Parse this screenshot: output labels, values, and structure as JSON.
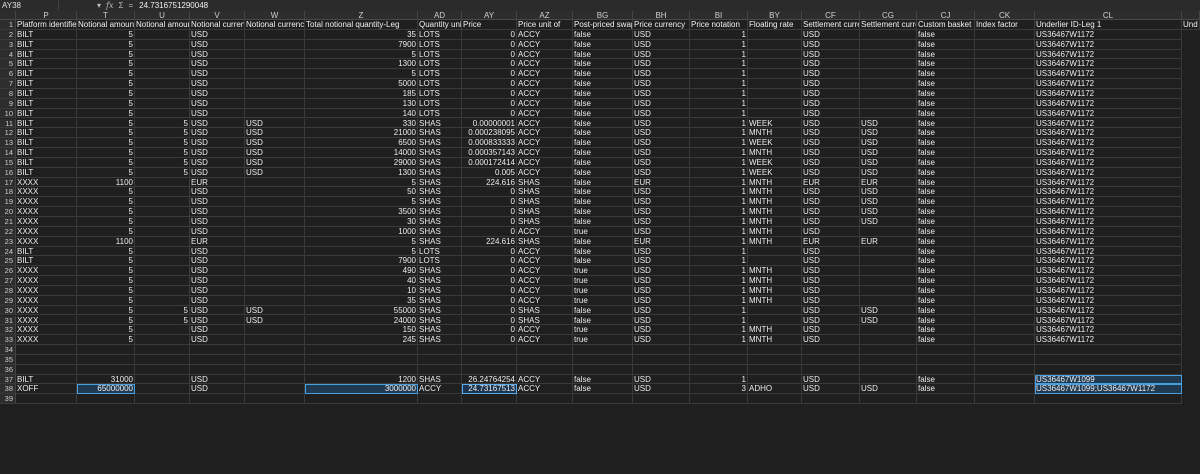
{
  "name_box": "AY38",
  "formula": {
    "fx": "fx",
    "sum": "Σ",
    "dropdown": "▾",
    "equals": "=",
    "value": "24.7316751290048"
  },
  "columns": [
    "P",
    "T",
    "U",
    "V",
    "W",
    "Z",
    "AD",
    "AY",
    "AZ",
    "BG",
    "BH",
    "BI",
    "BY",
    "CF",
    "CG",
    "CJ",
    "CK",
    "CL"
  ],
  "headers": [
    "Platform identifier",
    "Notional amount",
    "Notional amount",
    "Notional currency",
    "Notional currency",
    "Total notional quantity-Leg",
    "Quantity unit",
    "Price",
    "Price unit of",
    "Post-priced swap",
    "Price currency",
    "Price notation",
    "Floating rate",
    "Settlement currency",
    "Settlement currency",
    "Custom basket",
    "Index factor",
    "Underlier ID-Leg 1",
    "Und"
  ],
  "rows": [
    {
      "n": "2",
      "c": [
        "BILT",
        "5",
        "",
        "USD",
        "",
        "35",
        "LOTS",
        "0",
        "ACCY",
        "false",
        "USD",
        "1",
        "",
        "USD",
        "",
        "false",
        "",
        "US36467W1172"
      ]
    },
    {
      "n": "3",
      "c": [
        "BILT",
        "5",
        "",
        "USD",
        "",
        "7900",
        "LOTS",
        "0",
        "ACCY",
        "false",
        "USD",
        "1",
        "",
        "USD",
        "",
        "false",
        "",
        "US36467W1172"
      ]
    },
    {
      "n": "4",
      "c": [
        "BILT",
        "5",
        "",
        "USD",
        "",
        "5",
        "LOTS",
        "0",
        "ACCY",
        "false",
        "USD",
        "1",
        "",
        "USD",
        "",
        "false",
        "",
        "US36467W1172"
      ]
    },
    {
      "n": "5",
      "c": [
        "BILT",
        "5",
        "",
        "USD",
        "",
        "1300",
        "LOTS",
        "0",
        "ACCY",
        "false",
        "USD",
        "1",
        "",
        "USD",
        "",
        "false",
        "",
        "US36467W1172"
      ]
    },
    {
      "n": "6",
      "c": [
        "BILT",
        "5",
        "",
        "USD",
        "",
        "5",
        "LOTS",
        "0",
        "ACCY",
        "false",
        "USD",
        "1",
        "",
        "USD",
        "",
        "false",
        "",
        "US36467W1172"
      ]
    },
    {
      "n": "7",
      "c": [
        "BILT",
        "5",
        "",
        "USD",
        "",
        "5000",
        "LOTS",
        "0",
        "ACCY",
        "false",
        "USD",
        "1",
        "",
        "USD",
        "",
        "false",
        "",
        "US36467W1172"
      ]
    },
    {
      "n": "8",
      "c": [
        "BILT",
        "5",
        "",
        "USD",
        "",
        "185",
        "LOTS",
        "0",
        "ACCY",
        "false",
        "USD",
        "1",
        "",
        "USD",
        "",
        "false",
        "",
        "US36467W1172"
      ]
    },
    {
      "n": "9",
      "c": [
        "BILT",
        "5",
        "",
        "USD",
        "",
        "130",
        "LOTS",
        "0",
        "ACCY",
        "false",
        "USD",
        "1",
        "",
        "USD",
        "",
        "false",
        "",
        "US36467W1172"
      ]
    },
    {
      "n": "10",
      "c": [
        "BILT",
        "5",
        "",
        "USD",
        "",
        "140",
        "LOTS",
        "0",
        "ACCY",
        "false",
        "USD",
        "1",
        "",
        "USD",
        "",
        "false",
        "",
        "US36467W1172"
      ]
    },
    {
      "n": "11",
      "c": [
        "BILT",
        "5",
        "5",
        "USD",
        "USD",
        "330",
        "SHAS",
        "0.00000001",
        "ACCY",
        "false",
        "USD",
        "1",
        "WEEK",
        "USD",
        "USD",
        "false",
        "",
        "US36467W1172"
      ]
    },
    {
      "n": "12",
      "c": [
        "BILT",
        "5",
        "5",
        "USD",
        "USD",
        "21000",
        "SHAS",
        "0.000238095",
        "ACCY",
        "false",
        "USD",
        "1",
        "MNTH",
        "USD",
        "USD",
        "false",
        "",
        "US36467W1172"
      ]
    },
    {
      "n": "13",
      "c": [
        "BILT",
        "5",
        "5",
        "USD",
        "USD",
        "6500",
        "SHAS",
        "0.000833333",
        "ACCY",
        "false",
        "USD",
        "1",
        "WEEK",
        "USD",
        "USD",
        "false",
        "",
        "US36467W1172"
      ]
    },
    {
      "n": "14",
      "c": [
        "BILT",
        "5",
        "5",
        "USD",
        "USD",
        "14000",
        "SHAS",
        "0.000357143",
        "ACCY",
        "false",
        "USD",
        "1",
        "MNTH",
        "USD",
        "USD",
        "false",
        "",
        "US36467W1172"
      ]
    },
    {
      "n": "15",
      "c": [
        "BILT",
        "5",
        "5",
        "USD",
        "USD",
        "29000",
        "SHAS",
        "0.000172414",
        "ACCY",
        "false",
        "USD",
        "1",
        "WEEK",
        "USD",
        "USD",
        "false",
        "",
        "US36467W1172"
      ]
    },
    {
      "n": "16",
      "c": [
        "BILT",
        "5",
        "5",
        "USD",
        "USD",
        "1300",
        "SHAS",
        "0.005",
        "ACCY",
        "false",
        "USD",
        "1",
        "WEEK",
        "USD",
        "USD",
        "false",
        "",
        "US36467W1172"
      ]
    },
    {
      "n": "17",
      "c": [
        "XXXX",
        "1100",
        "",
        "EUR",
        "",
        "5",
        "SHAS",
        "224.616",
        "SHAS",
        "false",
        "EUR",
        "1",
        "MNTH",
        "EUR",
        "EUR",
        "false",
        "",
        "US36467W1172"
      ]
    },
    {
      "n": "18",
      "c": [
        "XXXX",
        "5",
        "",
        "USD",
        "",
        "50",
        "SHAS",
        "0",
        "SHAS",
        "false",
        "USD",
        "1",
        "MNTH",
        "USD",
        "USD",
        "false",
        "",
        "US36467W1172"
      ]
    },
    {
      "n": "19",
      "c": [
        "XXXX",
        "5",
        "",
        "USD",
        "",
        "5",
        "SHAS",
        "0",
        "SHAS",
        "false",
        "USD",
        "1",
        "MNTH",
        "USD",
        "USD",
        "false",
        "",
        "US36467W1172"
      ]
    },
    {
      "n": "20",
      "c": [
        "XXXX",
        "5",
        "",
        "USD",
        "",
        "3500",
        "SHAS",
        "0",
        "SHAS",
        "false",
        "USD",
        "1",
        "MNTH",
        "USD",
        "USD",
        "false",
        "",
        "US36467W1172"
      ]
    },
    {
      "n": "21",
      "c": [
        "XXXX",
        "5",
        "",
        "USD",
        "",
        "30",
        "SHAS",
        "0",
        "SHAS",
        "false",
        "USD",
        "1",
        "MNTH",
        "USD",
        "USD",
        "false",
        "",
        "US36467W1172"
      ]
    },
    {
      "n": "22",
      "c": [
        "XXXX",
        "5",
        "",
        "USD",
        "",
        "1000",
        "SHAS",
        "0",
        "ACCY",
        "true",
        "USD",
        "1",
        "MNTH",
        "USD",
        "",
        "false",
        "",
        "US36467W1172"
      ]
    },
    {
      "n": "23",
      "c": [
        "XXXX",
        "1100",
        "",
        "EUR",
        "",
        "5",
        "SHAS",
        "224.616",
        "SHAS",
        "false",
        "EUR",
        "1",
        "MNTH",
        "EUR",
        "EUR",
        "false",
        "",
        "US36467W1172"
      ]
    },
    {
      "n": "24",
      "c": [
        "BILT",
        "5",
        "",
        "USD",
        "",
        "5",
        "LOTS",
        "0",
        "ACCY",
        "false",
        "USD",
        "1",
        "",
        "USD",
        "",
        "false",
        "",
        "US36467W1172"
      ]
    },
    {
      "n": "25",
      "c": [
        "BILT",
        "5",
        "",
        "USD",
        "",
        "7900",
        "LOTS",
        "0",
        "ACCY",
        "false",
        "USD",
        "1",
        "",
        "USD",
        "",
        "false",
        "",
        "US36467W1172"
      ]
    },
    {
      "n": "26",
      "c": [
        "XXXX",
        "5",
        "",
        "USD",
        "",
        "490",
        "SHAS",
        "0",
        "ACCY",
        "true",
        "USD",
        "1",
        "MNTH",
        "USD",
        "",
        "false",
        "",
        "US36467W1172"
      ]
    },
    {
      "n": "27",
      "c": [
        "XXXX",
        "5",
        "",
        "USD",
        "",
        "40",
        "SHAS",
        "0",
        "ACCY",
        "true",
        "USD",
        "1",
        "MNTH",
        "USD",
        "",
        "false",
        "",
        "US36467W1172"
      ]
    },
    {
      "n": "28",
      "c": [
        "XXXX",
        "5",
        "",
        "USD",
        "",
        "10",
        "SHAS",
        "0",
        "ACCY",
        "true",
        "USD",
        "1",
        "MNTH",
        "USD",
        "",
        "false",
        "",
        "US36467W1172"
      ]
    },
    {
      "n": "29",
      "c": [
        "XXXX",
        "5",
        "",
        "USD",
        "",
        "35",
        "SHAS",
        "0",
        "ACCY",
        "true",
        "USD",
        "1",
        "MNTH",
        "USD",
        "",
        "false",
        "",
        "US36467W1172"
      ]
    },
    {
      "n": "30",
      "c": [
        "XXXX",
        "5",
        "5",
        "USD",
        "USD",
        "55000",
        "SHAS",
        "0",
        "SHAS",
        "false",
        "USD",
        "1",
        "",
        "USD",
        "USD",
        "false",
        "",
        "US36467W1172"
      ]
    },
    {
      "n": "31",
      "c": [
        "XXXX",
        "5",
        "5",
        "USD",
        "USD",
        "24000",
        "SHAS",
        "0",
        "SHAS",
        "false",
        "USD",
        "1",
        "",
        "USD",
        "USD",
        "false",
        "",
        "US36467W1172"
      ]
    },
    {
      "n": "32",
      "c": [
        "XXXX",
        "5",
        "",
        "USD",
        "",
        "150",
        "SHAS",
        "0",
        "ACCY",
        "true",
        "USD",
        "1",
        "MNTH",
        "USD",
        "",
        "false",
        "",
        "US36467W1172"
      ]
    },
    {
      "n": "33",
      "c": [
        "XXXX",
        "5",
        "",
        "USD",
        "",
        "245",
        "SHAS",
        "0",
        "ACCY",
        "true",
        "USD",
        "1",
        "MNTH",
        "USD",
        "",
        "false",
        "",
        "US36467W1172"
      ]
    },
    {
      "n": "34",
      "c": [
        "",
        "",
        "",
        "",
        "",
        "",
        "",
        "",
        "",
        "",
        "",
        "",
        "",
        "",
        "",
        "",
        "",
        ""
      ]
    },
    {
      "n": "35",
      "c": [
        "",
        "",
        "",
        "",
        "",
        "",
        "",
        "",
        "",
        "",
        "",
        "",
        "",
        "",
        "",
        "",
        "",
        ""
      ]
    },
    {
      "n": "36",
      "c": [
        "",
        "",
        "",
        "",
        "",
        "",
        "",
        "",
        "",
        "",
        "",
        "",
        "",
        "",
        "",
        "",
        "",
        ""
      ]
    },
    {
      "n": "37",
      "c": [
        "BILT",
        "31000",
        "",
        "USD",
        "",
        "1200",
        "SHAS",
        "26.24764254",
        "ACCY",
        "false",
        "USD",
        "1",
        "",
        "USD",
        "",
        "false",
        "",
        "US36467W1099"
      ]
    },
    {
      "n": "38",
      "c": [
        "XOFF",
        "65000000",
        "",
        "USD",
        "",
        "3000000",
        "ACCY",
        "24.73167513",
        "ACCY",
        "false",
        "USD",
        "3",
        "ADHO",
        "USD",
        "USD",
        "false",
        "",
        "US36467W1099;US36467W1172"
      ]
    },
    {
      "n": "39",
      "c": [
        "",
        "",
        "",
        "",
        "",
        "",
        "",
        "",
        "",
        "",
        "",
        "",
        "",
        "",
        "",
        "",
        "",
        ""
      ]
    }
  ]
}
